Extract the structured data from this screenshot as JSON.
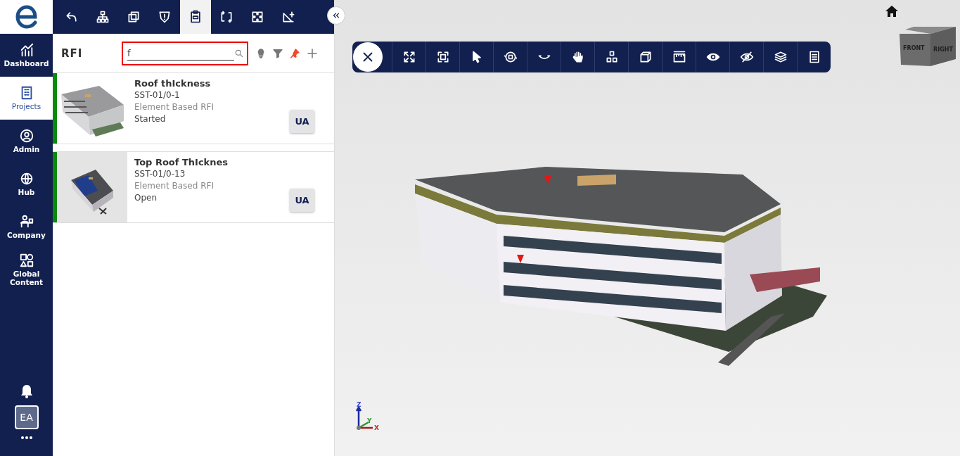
{
  "nav": {
    "items": [
      {
        "label": "Dashboard",
        "selected": false
      },
      {
        "label": "Projects",
        "selected": true
      },
      {
        "label": "Admin",
        "selected": false
      },
      {
        "label": "Hub",
        "selected": false
      },
      {
        "label": "Company",
        "selected": false
      },
      {
        "label": "Global Content",
        "selected": false
      }
    ],
    "user_initials": "EA"
  },
  "panel_tabs": [
    {
      "selected": false
    },
    {
      "selected": false
    },
    {
      "selected": false
    },
    {
      "selected": false
    },
    {
      "selected": true
    },
    {
      "selected": false
    },
    {
      "selected": false
    },
    {
      "selected": false
    }
  ],
  "panel": {
    "title": "RFI",
    "search": {
      "value": "f"
    }
  },
  "rfis": [
    {
      "title": "Roof thIckness",
      "code": "SST-01/0-1",
      "type": "Element Based RFI",
      "status": "Started",
      "assignee": "UA",
      "color": "#0a8a0a"
    },
    {
      "title": "Top Roof ThIcknes",
      "code": "SST-01/0-13",
      "type": "Element Based RFI",
      "status": "Open",
      "assignee": "UA",
      "color": "#0a8a0a"
    }
  ],
  "viewer": {
    "view_cube": {
      "front": "FRONT",
      "right": "RIGHT"
    },
    "axes": {
      "z": "Z",
      "y": "Y",
      "x": "X"
    }
  }
}
